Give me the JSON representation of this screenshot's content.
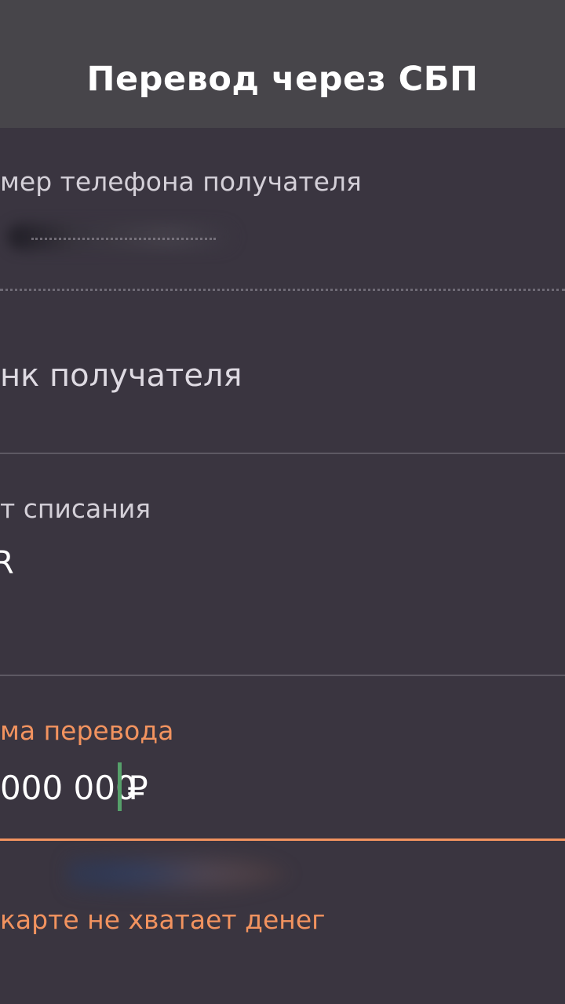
{
  "header": {
    "title": "Перевод через СБП"
  },
  "form": {
    "phone": {
      "label": "мер телефона получателя"
    },
    "bank": {
      "placeholder": "нк получателя"
    },
    "account": {
      "label": "т списания",
      "value": "R"
    },
    "amount": {
      "label": "ма перевода",
      "value": "000 000",
      "currency": "₽"
    },
    "error": "карте не хватает денег"
  },
  "colors": {
    "accent": "#f2935f",
    "cursor": "#56a06a",
    "background": "#3a3540",
    "header": "#47454a"
  }
}
